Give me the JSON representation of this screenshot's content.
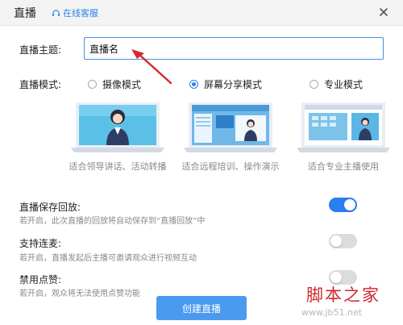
{
  "header": {
    "title": "直播",
    "service_label": "在线客服"
  },
  "form": {
    "topic_label": "直播主题:",
    "topic_value": "直播名",
    "mode_label": "直播模式:"
  },
  "modes": [
    {
      "label": "摄像模式",
      "selected": false,
      "caption": "适合领导讲话、活动转播"
    },
    {
      "label": "屏幕分享模式",
      "selected": true,
      "caption": "适合远程培训、操作演示"
    },
    {
      "label": "专业模式",
      "selected": false,
      "caption": "适合专业主播使用"
    }
  ],
  "settings": [
    {
      "title": "直播保存回放:",
      "desc": "若开启，此次直播的回放将自动保存到“直播回放”中",
      "enabled": true
    },
    {
      "title": "支持连麦:",
      "desc": "若开启，直播发起后主播可邀请观众进行视频互动",
      "enabled": false
    },
    {
      "title": "禁用点赞:",
      "desc": "若开启，观众将无法使用点赞功能",
      "enabled": false
    }
  ],
  "actions": {
    "create_label": "创建直播"
  },
  "watermark": {
    "title": "脚本之家",
    "url": "www.jb51.net"
  },
  "colors": {
    "accent": "#2a7ff0",
    "button": "#4a9af0",
    "arrow": "#d9262c",
    "toggle_off": "#dcdcdc"
  }
}
